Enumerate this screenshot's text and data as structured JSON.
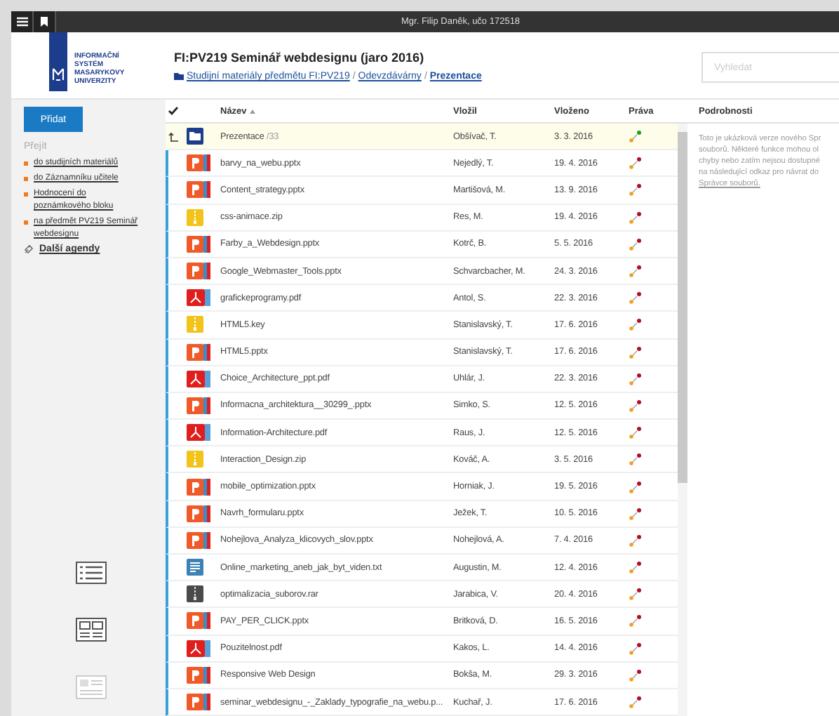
{
  "top_bar": {
    "user": "Mgr. Filip Daněk, učo 172518"
  },
  "logo": {
    "lines": [
      "INFORMAČNÍ",
      "SYSTÉM",
      "MASARYKOVY",
      "UNIVERZITY"
    ]
  },
  "header": {
    "title": "FI:PV219 Seminář webdesignu (jaro 2016)",
    "separator": "/",
    "breadcrumbs": [
      {
        "label": "Studijní materiály předmětu FI:PV219",
        "current": false
      },
      {
        "label": "Odevzdávárny",
        "current": false
      },
      {
        "label": "Prezentace",
        "current": true
      }
    ]
  },
  "search": {
    "placeholder": "Vyhledat"
  },
  "sidebar": {
    "add_button": "Přidat",
    "goto_heading": "Přejít",
    "links": [
      "do studijních materiálů",
      "do Záznamníku učitele",
      "Hodnocení do poznámkového bloku",
      "na předmět PV219 Seminář webdesignu"
    ],
    "more_link": "Další agendy"
  },
  "table": {
    "columns": [
      "Název",
      "Vložil",
      "Vloženo",
      "Práva"
    ],
    "parent_row": {
      "name": "Prezentace",
      "count": "/33",
      "author": "Obšívač, T.",
      "date": "3. 3. 2016",
      "color": "#22a022"
    },
    "rows": [
      {
        "kind": "pptx",
        "name": "barvy_na_webu.pptx",
        "author": "Nejedlý, T.",
        "date": "19. 4. 2016",
        "color": "#b0102a"
      },
      {
        "kind": "pptx",
        "name": "Content_strategy.pptx",
        "author": "Martišová, M.",
        "date": "13. 9. 2016",
        "color": "#b0102a"
      },
      {
        "kind": "zip",
        "name": "css-animace.zip",
        "author": "Res, M.",
        "date": "19. 4. 2016",
        "color": "#b0102a"
      },
      {
        "kind": "pptx",
        "name": "Farby_a_Webdesign.pptx",
        "author": "Kotrč, B.",
        "date": "5. 5. 2016",
        "color": "#b0102a"
      },
      {
        "kind": "pptx",
        "name": "Google_Webmaster_Tools.pptx",
        "author": "Schvarcbacher, M.",
        "date": "24. 3. 2016",
        "color": "#b0102a"
      },
      {
        "kind": "pdf",
        "name": "grafickeprogramy.pdf",
        "author": "Antol, S.",
        "date": "22. 3. 2016",
        "color": "#b0102a"
      },
      {
        "kind": "zip",
        "name": "HTML5.key",
        "author": "Stanislavský, T.",
        "date": "17. 6. 2016",
        "color": "#b0102a"
      },
      {
        "kind": "pptx",
        "name": "HTML5.pptx",
        "author": "Stanislavský, T.",
        "date": "17. 6. 2016",
        "color": "#b0102a"
      },
      {
        "kind": "pdf",
        "name": "Choice_Architecture_ppt.pdf",
        "author": "Uhlár, J.",
        "date": "22. 3. 2016",
        "color": "#b0102a"
      },
      {
        "kind": "pptx",
        "name": "Informacna_architektura__30299_.pptx",
        "author": "Simko, S.",
        "date": "12. 5. 2016",
        "color": "#b0102a"
      },
      {
        "kind": "pdf",
        "name": "Information-Architecture.pdf",
        "author": "Raus, J.",
        "date": "12. 5. 2016",
        "color": "#b0102a"
      },
      {
        "kind": "zip",
        "name": "Interaction_Design.zip",
        "author": "Kováč, A.",
        "date": "3. 5. 2016",
        "color": "#b0102a"
      },
      {
        "kind": "pptx",
        "name": "mobile_optimization.pptx",
        "author": "Horniak, J.",
        "date": "19. 5. 2016",
        "color": "#b0102a"
      },
      {
        "kind": "pptx",
        "name": "Navrh_formularu.pptx",
        "author": "Ježek, T.",
        "date": "10. 5. 2016",
        "color": "#b0102a"
      },
      {
        "kind": "pptx",
        "name": "Nohejlova_Analyza_klicovych_slov.pptx",
        "author": "Nohejlová, A.",
        "date": "7. 4. 2016",
        "color": "#b0102a"
      },
      {
        "kind": "txt",
        "name": "Online_marketing_aneb_jak_byt_viden.txt",
        "author": "Augustin, M.",
        "date": "12. 4. 2016",
        "color": "#b0102a"
      },
      {
        "kind": "rar",
        "name": "optimalizacia_suborov.rar",
        "author": "Jarabica, V.",
        "date": "20. 4. 2016",
        "color": "#b0102a"
      },
      {
        "kind": "pptx",
        "name": "PAY_PER_CLICK.pptx",
        "author": "Britková, D.",
        "date": "16. 5. 2016",
        "color": "#b0102a"
      },
      {
        "kind": "pdf",
        "name": "Pouzitelnost.pdf",
        "author": "Kakos, L.",
        "date": "14. 4. 2016",
        "color": "#b0102a"
      },
      {
        "kind": "pptx",
        "name": "Responsive Web Design",
        "author": "Bokša, M.",
        "date": "29. 3. 2016",
        "color": "#b0102a"
      },
      {
        "kind": "pptx",
        "name": "seminar_webdesignu_-_Zaklady_typografie_na_webu.p...",
        "author": "Kuchař, J.",
        "date": "17. 6. 2016",
        "color": "#b0102a"
      }
    ]
  },
  "details": {
    "heading": "Podrobnosti",
    "lines": [
      "Toto je ukázková verze nového Spr",
      "souborů. Některé funkce mohou ol",
      "chyby nebo zatím nejsou dostupné",
      "na následující odkaz pro návrat do"
    ],
    "link": "Správce souborů."
  }
}
